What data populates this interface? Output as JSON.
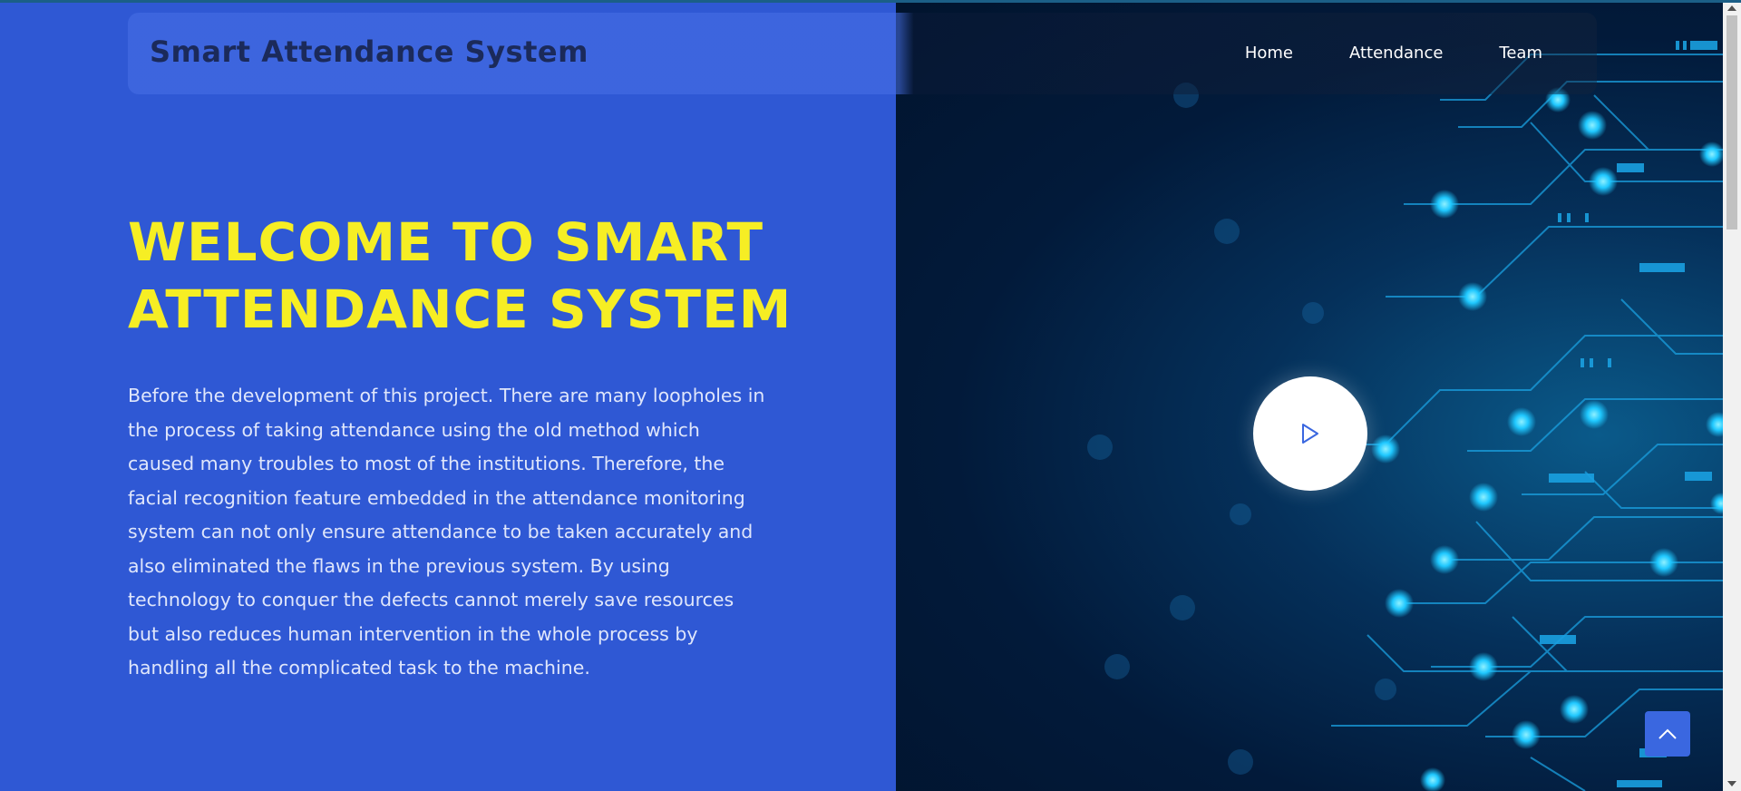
{
  "navbar": {
    "brand": "Smart Attendance System",
    "links": [
      "Home",
      "Attendance",
      "Team"
    ]
  },
  "hero": {
    "title_line1": "WELCOME TO SMART",
    "title_line2": "ATTENDANCE SYSTEM",
    "paragraph": "Before the development of this project. There are many loopholes in the process of taking attendance using the old method which caused many troubles to most of the institutions. Therefore, the facial recognition feature embedded in the attendance monitoring system can not only ensure attendance to be taken accurately and also eliminated the flaws in the previous system. By using technology to conquer the defects cannot merely save resources but also reduces human intervention in the whole process by handling all the complicated task to the machine."
  },
  "media": {
    "play_icon": "play-icon",
    "back_to_top_icon": "chevron-up-icon"
  },
  "colors": {
    "left_panel": "#2f58d4",
    "title": "#f6ee24",
    "brand_text": "#1b2a5a",
    "accent_button": "#3a67e0",
    "circuit_glow": "#1fc8ff"
  }
}
